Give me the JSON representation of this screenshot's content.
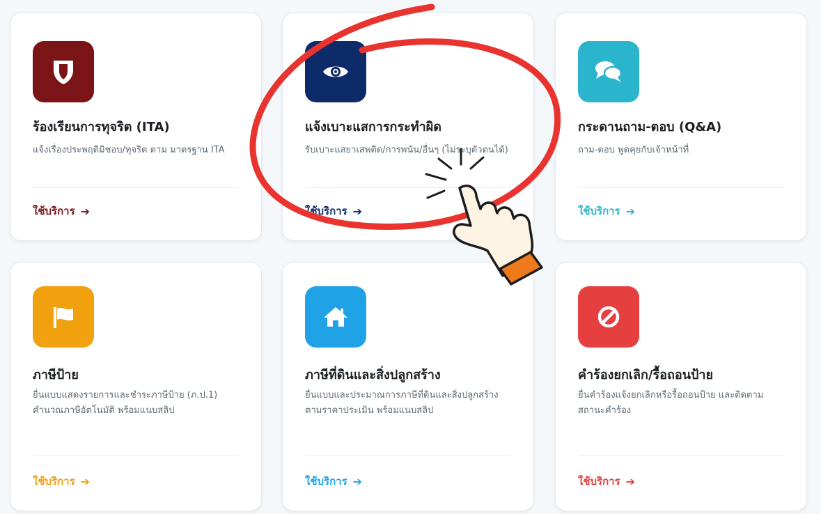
{
  "colors": {
    "card_ita": "#7a1417",
    "card_report": "#0d2b68",
    "card_qa": "#2bb5cd",
    "card_signtax": "#f1a00e",
    "card_landtax": "#1fa3e6",
    "card_cancel": "#e53f3f",
    "annotation_red": "#e8332f",
    "hand_cuff": "#ef7a1c"
  },
  "cards": [
    {
      "id": "ita",
      "icon": "shield-icon",
      "title": "ร้องเรียนการทุจริต (ITA)",
      "desc": "แจ้งเรื่องประพฤติมิชอบ/ทุจริต ตาม มาตรฐาน ITA",
      "link": "ใช้บริการ",
      "arrow": "➔"
    },
    {
      "id": "report",
      "icon": "eye-icon",
      "title": "แจ้งเบาะแสการกระทำผิด",
      "desc": "รับเบาะแสยาเสพติด/การพนัน/อื่นๆ (ไม่ระบุตัวตนได้)",
      "link": "ใช้บริการ",
      "arrow": "➔"
    },
    {
      "id": "qa",
      "icon": "chat-bubbles-icon",
      "title": "กระดานถาม-ตอบ (Q&A)",
      "desc": "ถาม-ตอบ พูดคุยกับเจ้าหน้าที่",
      "link": "ใช้บริการ",
      "arrow": "➔"
    },
    {
      "id": "signtax",
      "icon": "flag-icon",
      "title": "ภาษีป้าย",
      "desc": "ยื่นแบบแสดงรายการและชำระภาษีป้าย (ภ.ป.1) คำนวณภาษีอัตโนมัติ พร้อมแนบสลิป",
      "link": "ใช้บริการ",
      "arrow": "➔"
    },
    {
      "id": "landtax",
      "icon": "home-icon",
      "title": "ภาษีที่ดินและสิ่งปลูกสร้าง",
      "desc": "ยื่นแบบและประมาณการภาษีที่ดินและสิ่งปลูกสร้างตามราคาประเมิน พร้อมแนบสลิป",
      "link": "ใช้บริการ",
      "arrow": "➔"
    },
    {
      "id": "cancel",
      "icon": "ban-icon",
      "title": "คำร้องยกเลิก/รื้อถอนป้าย",
      "desc": "ยื่นคำร้องแจ้งยกเลิกหรือรื้อถอนป้าย และติดตามสถานะคำร้อง",
      "link": "ใช้บริการ",
      "arrow": "➔"
    }
  ]
}
